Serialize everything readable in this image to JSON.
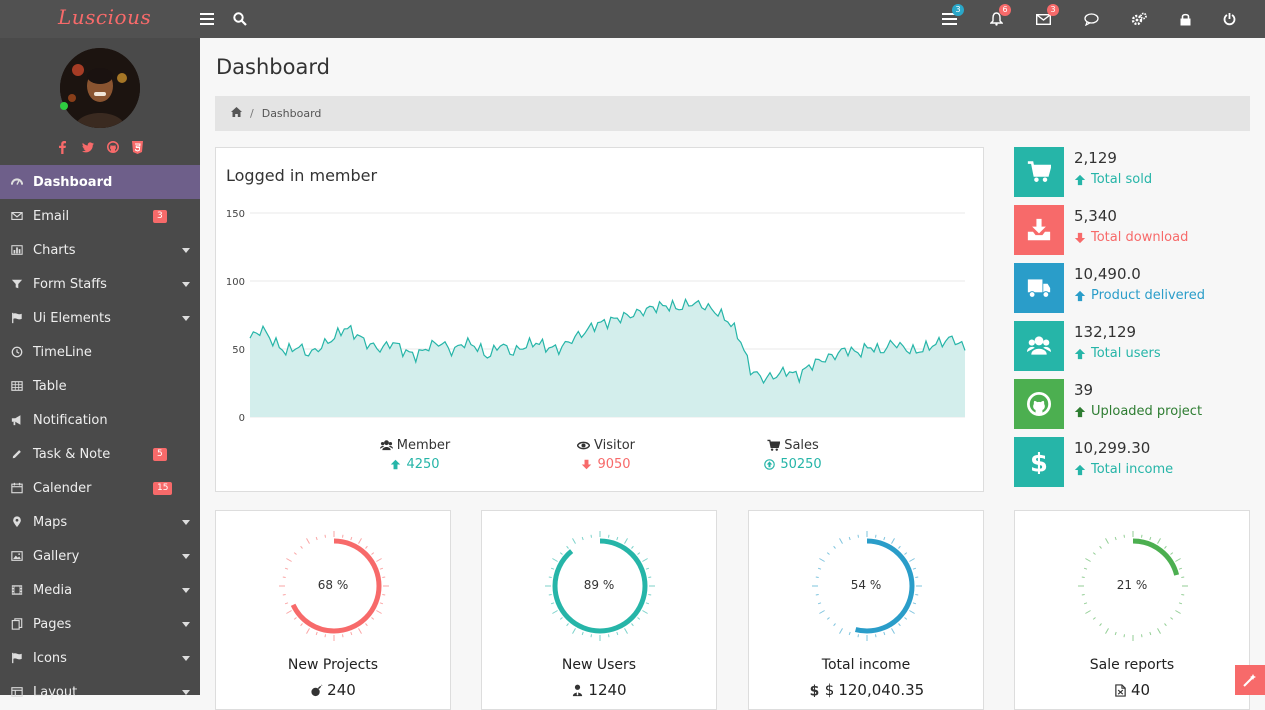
{
  "brand": "Luscious",
  "topbar": {
    "badges": {
      "tasks": "3",
      "notifications": "6",
      "messages": "3"
    },
    "colors": {
      "tasks": "#2aa7c9",
      "notifications": "#f76a6a",
      "messages": "#f76a6a"
    }
  },
  "sidebar": {
    "items": [
      {
        "label": "Dashboard",
        "icon": "dashboard-icon",
        "active": true
      },
      {
        "label": "Email",
        "icon": "envelope-icon",
        "badge": "3"
      },
      {
        "label": "Charts",
        "icon": "bar-chart-icon",
        "caret": true
      },
      {
        "label": "Form Staffs",
        "icon": "filter-icon",
        "caret": true
      },
      {
        "label": "Ui Elements",
        "icon": "flag-icon",
        "caret": true
      },
      {
        "label": "TimeLine",
        "icon": "clock-icon"
      },
      {
        "label": "Table",
        "icon": "table-icon"
      },
      {
        "label": "Notification",
        "icon": "bullhorn-icon"
      },
      {
        "label": "Task & Note",
        "icon": "pencil-icon",
        "badge": "5"
      },
      {
        "label": "Calender",
        "icon": "calendar-icon",
        "badge": "15"
      },
      {
        "label": "Maps",
        "icon": "map-marker-icon",
        "caret": true
      },
      {
        "label": "Gallery",
        "icon": "image-icon",
        "caret": true
      },
      {
        "label": "Media",
        "icon": "film-icon",
        "caret": true
      },
      {
        "label": "Pages",
        "icon": "files-icon",
        "caret": true
      },
      {
        "label": "Icons",
        "icon": "flag-icon",
        "caret": true
      },
      {
        "label": "Layout",
        "icon": "layout-icon",
        "caret": true
      }
    ]
  },
  "page": {
    "title": "Dashboard",
    "breadcrumb": "Dashboard"
  },
  "chart_panel": {
    "title": "Logged in member",
    "legend": [
      {
        "name": "Member",
        "value": "4250",
        "trend": "up",
        "color": "#26b5a8"
      },
      {
        "name": "Visitor",
        "value": "9050",
        "trend": "down",
        "color": "#f76a6a"
      },
      {
        "name": "Sales",
        "value": "50250",
        "trend": "up-circle",
        "color": "#26b5a8"
      }
    ]
  },
  "chart_data": {
    "type": "area",
    "title": "Logged in member",
    "ylim": [
      0,
      150
    ],
    "yticks": [
      "0",
      "50",
      "100",
      "150"
    ],
    "grid": true,
    "color": "#26b5a8",
    "fill": "#d3eeec",
    "x": [
      0,
      2,
      4,
      6,
      8,
      10,
      12,
      14,
      16,
      18,
      20,
      22,
      24,
      26,
      28,
      30,
      32,
      34,
      36,
      38,
      40,
      42,
      44,
      46,
      48,
      50,
      52,
      54,
      56,
      58,
      60,
      62,
      64,
      66,
      68,
      70,
      72,
      74,
      76,
      78,
      80,
      82,
      84,
      86,
      88,
      90,
      92,
      94,
      96,
      98,
      100
    ],
    "values": [
      58,
      65,
      55,
      48,
      52,
      46,
      52,
      58,
      66,
      60,
      53,
      50,
      55,
      48,
      45,
      52,
      55,
      48,
      55,
      52,
      44,
      54,
      47,
      52,
      55,
      51,
      50,
      57,
      62,
      68,
      70,
      73,
      75,
      78,
      81,
      82,
      80,
      84,
      82,
      78,
      72,
      60,
      35,
      28,
      30,
      34,
      30,
      38,
      42,
      45,
      50,
      47,
      52,
      48,
      55,
      50,
      48,
      52,
      55,
      58,
      50
    ],
    "x_note": ""
  },
  "stats": [
    {
      "value": "2,129",
      "label": "Total sold",
      "trend": "up",
      "color": "#26b5a8",
      "icon": "cart-icon"
    },
    {
      "value": "5,340",
      "label": "Total download",
      "trend": "down",
      "color": "#f76a6a",
      "icon": "download-icon"
    },
    {
      "value": "10,490.0",
      "label": "Product delivered",
      "trend": "up",
      "color": "#2a9dc9",
      "icon": "truck-icon"
    },
    {
      "value": "132,129",
      "label": "Total users",
      "trend": "up",
      "color": "#26b5a8",
      "icon": "users-icon"
    },
    {
      "value": "39",
      "label": "Uploaded project",
      "trend": "up",
      "color": "#4caf50",
      "icon": "github-icon",
      "label_color": "#2e7d32"
    },
    {
      "value": "10,299.30",
      "label": "Total income",
      "trend": "up",
      "color": "#26b5a8",
      "icon": "dollar-icon"
    }
  ],
  "gauges": [
    {
      "title": "New Projects",
      "percent": 68,
      "pct_label": "68 %",
      "value": "240",
      "color": "#f76a6a",
      "icon": "bomb-icon"
    },
    {
      "title": "New Users",
      "percent": 89,
      "pct_label": "89 %",
      "value": "1240",
      "color": "#26b5a8",
      "icon": "user-tie-icon"
    },
    {
      "title": "Total income",
      "percent": 54,
      "pct_label": "54 %",
      "value": "120,040.35",
      "color": "#2a9dc9",
      "icon": "dollar-icon",
      "prefix": "$"
    },
    {
      "title": "Sale reports",
      "percent": 21,
      "pct_label": "21 %",
      "value": "40",
      "color": "#4caf50",
      "icon": "file-icon"
    }
  ]
}
